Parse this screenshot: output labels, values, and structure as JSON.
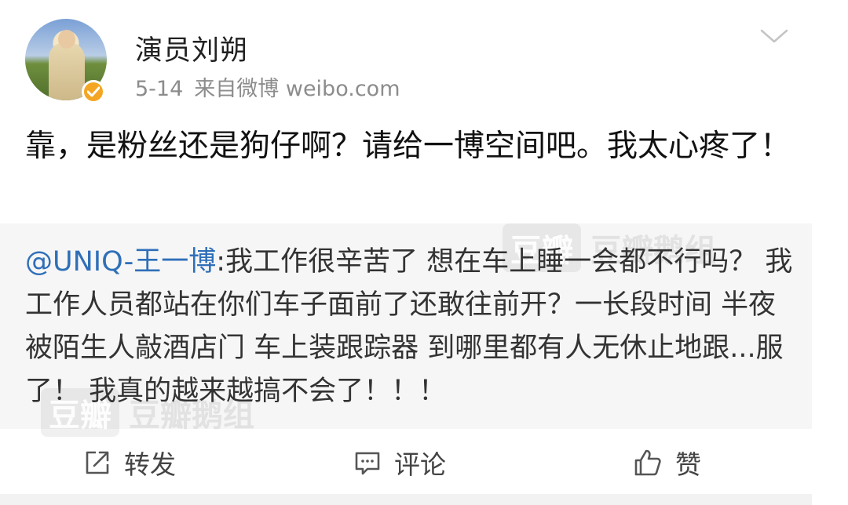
{
  "header": {
    "username": "演员刘朔",
    "date": "5-14",
    "source": "来自微博 weibo.com"
  },
  "post": {
    "text": "靠，是粉丝还是狗仔啊？请给一博空间吧。我太心疼了！"
  },
  "repost": {
    "mention": "@UNIQ-王一博",
    "text": ":我工作很辛苦了 想在车上睡一会都不行吗？ 我工作人员都站在你们车子面前了还敢往前开？一长段时间 半夜被陌生人敲酒店门 车上装跟踪器 到哪里都有人无休止地跟...服了！ 我真的越来越搞不会了！！！"
  },
  "watermarks": {
    "box_text": "豆瓣",
    "label": "豆瓣鹅组"
  },
  "actions": {
    "repost_label": "转发",
    "comment_label": "评论",
    "like_label": "赞"
  },
  "colors": {
    "mention": "#2f6fb8",
    "verified_badge": "#f4a623",
    "repost_background": "#f6f6f6"
  },
  "icons": {
    "verified": "verified-badge-icon",
    "chevron": "chevron-down-icon",
    "repost": "share-icon",
    "comment": "comment-icon",
    "like": "thumbs-up-icon"
  }
}
